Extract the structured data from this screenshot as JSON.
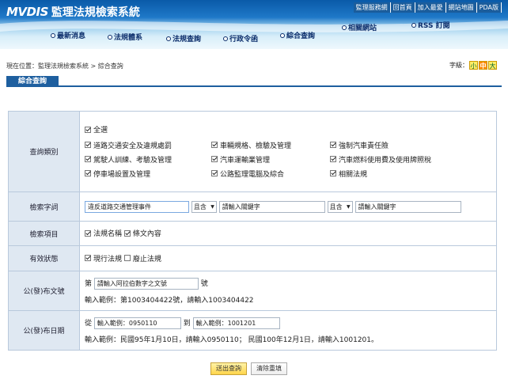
{
  "header": {
    "logo_en": "MVDIS",
    "logo_zh": "監理法規檢索系統",
    "top_links": [
      "監理服務網",
      "回首頁",
      "加入最愛",
      "網站地圖",
      "PDA版"
    ],
    "nav": [
      "最新消息",
      "法規體系",
      "法規查詢",
      "行政令函",
      "綜合查詢",
      "相關網站",
      "RSS 訂閱"
    ]
  },
  "breadcrumb": "現在位置：監理法規檢索系統 > 綜合查詢",
  "font_size": {
    "label": "字級：",
    "small": "小",
    "medium": "中",
    "large": "大"
  },
  "section_title": "綜合查詢",
  "form": {
    "category": {
      "label": "查詢類別",
      "all": {
        "label": "全選",
        "checked": true
      },
      "options": [
        {
          "label": "道路交通安全及違規處罰",
          "checked": true
        },
        {
          "label": "車輛規格、檢驗及管理",
          "checked": true
        },
        {
          "label": "強制汽車責任險",
          "checked": true
        },
        {
          "label": "駕駛人訓練、考驗及管理",
          "checked": true
        },
        {
          "label": "汽車運輸業管理",
          "checked": true
        },
        {
          "label": "汽車燃料使用費及使用牌照稅",
          "checked": true
        },
        {
          "label": "停車場設置及管理",
          "checked": true
        },
        {
          "label": "公路監理電腦及綜合",
          "checked": true
        },
        {
          "label": "相關法規",
          "checked": true
        }
      ]
    },
    "keywords": {
      "label": "檢索字詞",
      "kw1": "違反道路交通管理事件",
      "op1": "且含",
      "kw2": "請輸入關鍵字",
      "op2": "且含",
      "kw3": "請輸入關鍵字"
    },
    "items": {
      "label": "檢索項目",
      "opts": [
        {
          "label": "法規名稱",
          "checked": true
        },
        {
          "label": "條文內容",
          "checked": true
        }
      ]
    },
    "status": {
      "label": "有效狀態",
      "opts": [
        {
          "label": "現行法規",
          "checked": true
        },
        {
          "label": "廢止法規",
          "checked": false
        }
      ]
    },
    "doc_no": {
      "label": "公(發)布文號",
      "prefix": "第",
      "placeholder": "請輸入阿拉伯數字之文號",
      "suffix": "號",
      "hint": "輸入範例：第1003404422號，請輸入1003404422"
    },
    "date": {
      "label": "公(發)布日期",
      "from": "從",
      "from_value": "輸入範例：0950110",
      "to": "到",
      "to_value": "輸入範例：1001201",
      "hint": "輸入範例：民國95年1月10日，請輸入0950110； 民國100年12月1日，請輸入1001201。"
    }
  },
  "buttons": {
    "submit": "送出查詢",
    "reset": "清除重填"
  }
}
